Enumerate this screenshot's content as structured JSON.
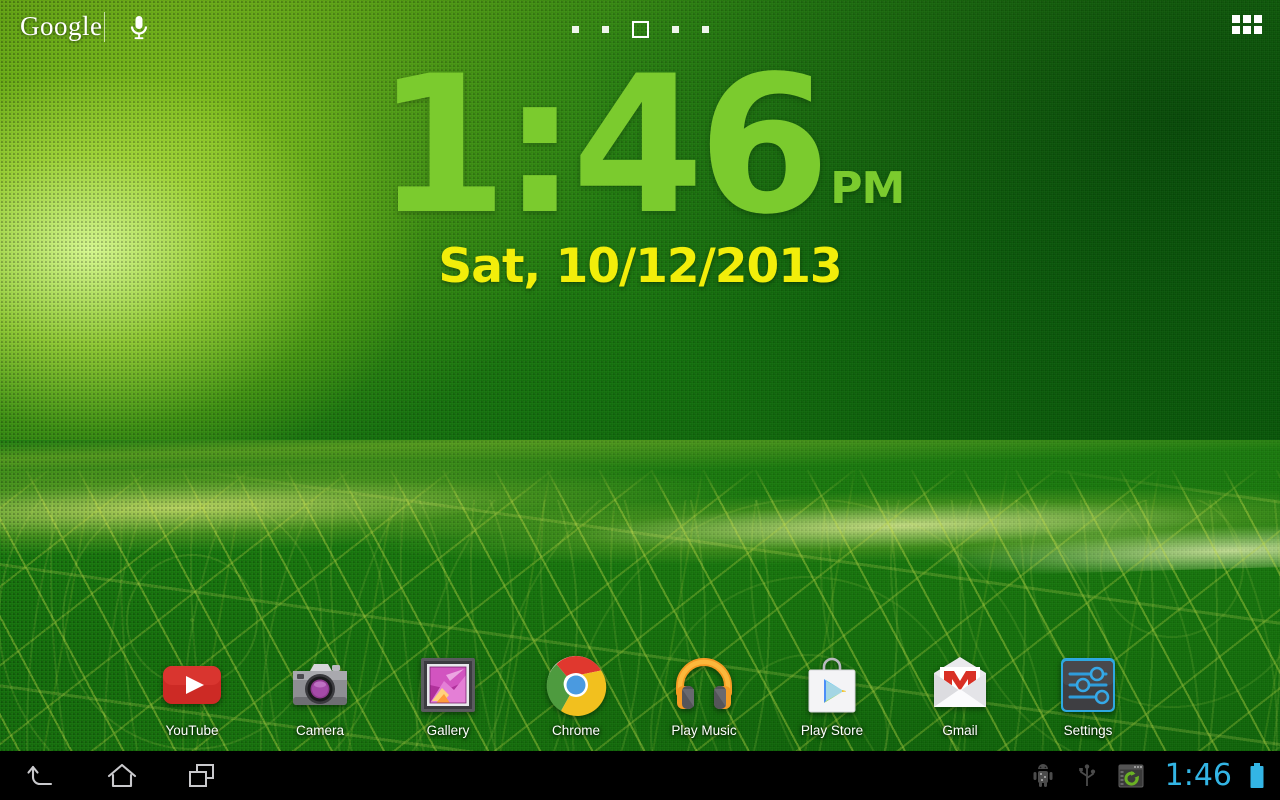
{
  "search": {
    "logo_text": "Google",
    "mic_icon": "microphone-icon"
  },
  "page_indicator": {
    "count": 5,
    "current_index": 2
  },
  "apps_button": {
    "icon": "apps-grid-icon"
  },
  "clock_widget": {
    "time": "1:46",
    "ampm": "PM",
    "date": "Sat, 10/12/2013",
    "time_color": "#7bcb2e",
    "date_color": "#f2ee0a"
  },
  "apps": [
    {
      "label": "YouTube",
      "icon": "youtube-icon"
    },
    {
      "label": "Camera",
      "icon": "camera-icon"
    },
    {
      "label": "Gallery",
      "icon": "gallery-icon"
    },
    {
      "label": "Chrome",
      "icon": "chrome-icon"
    },
    {
      "label": "Play Music",
      "icon": "play-music-icon"
    },
    {
      "label": "Play Store",
      "icon": "play-store-icon"
    },
    {
      "label": "Gmail",
      "icon": "gmail-icon"
    },
    {
      "label": "Settings",
      "icon": "settings-icon"
    }
  ],
  "nav_bar": {
    "back_icon": "back-arrow-icon",
    "home_icon": "home-icon",
    "recents_icon": "recent-apps-icon",
    "status": {
      "adb_icon": "android-debug-icon",
      "usb_icon": "usb-icon",
      "sync_icon": "sync-window-icon",
      "clock": "1:46",
      "clock_color": "#33b5e5",
      "battery_icon": "battery-full-icon"
    }
  }
}
